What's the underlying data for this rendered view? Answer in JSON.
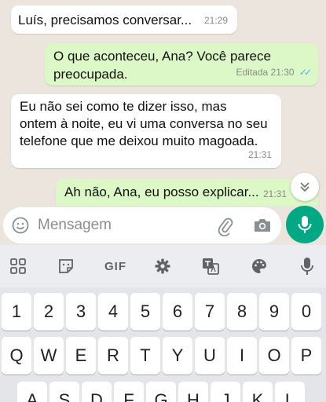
{
  "messages": [
    {
      "direction": "in",
      "text_lines": [
        "Luís, precisamos conversar..."
      ],
      "time": "21:29"
    },
    {
      "direction": "out",
      "text_lines": [
        "O que aconteceu, Ana? Você parece",
        "preocupada."
      ],
      "edited_label": "Editada",
      "time": "21:30",
      "status": "read"
    },
    {
      "direction": "in",
      "text_lines": [
        "Eu não sei como te dizer isso, mas",
        "ontem à noite, eu vi uma conversa no seu",
        "telefone que me deixou muito magoada."
      ],
      "time": "21:31"
    },
    {
      "direction": "out",
      "text_lines": [
        "Ah não, Ana, eu posso explicar..."
      ],
      "time": "21:31"
    }
  ],
  "composer": {
    "placeholder": "Mensagem"
  },
  "toolbar": {
    "gif_label": "GIF"
  },
  "keyboard": {
    "number_row": [
      "1",
      "2",
      "3",
      "4",
      "5",
      "6",
      "7",
      "8",
      "9",
      "0"
    ],
    "row1": [
      "Q",
      "W",
      "E",
      "R",
      "T",
      "Y",
      "U",
      "I",
      "O",
      "P"
    ],
    "row2": [
      "A",
      "S",
      "D",
      "F",
      "G",
      "H",
      "J",
      "K",
      "L"
    ]
  },
  "colors": {
    "chat_bg": "#ECE5DD",
    "incoming_bubble": "#FFFFFF",
    "outgoing_bubble": "#DCF8C6",
    "read_ticks": "#4FB6EC",
    "mic_button": "#00A884"
  }
}
